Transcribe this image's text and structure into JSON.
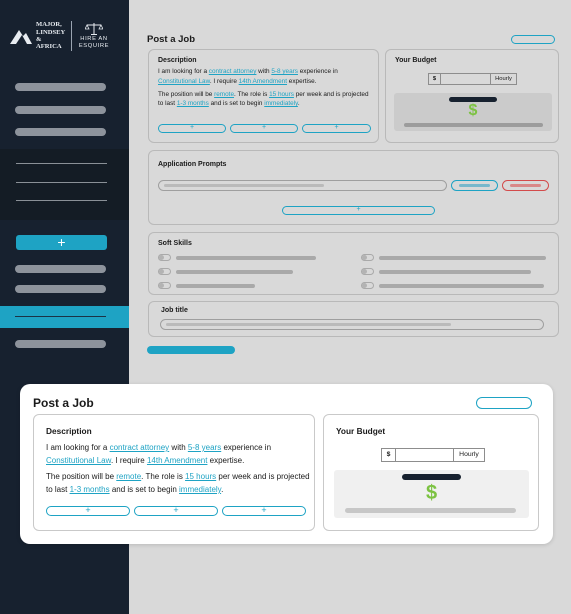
{
  "brand": {
    "left_lines": [
      "MAJOR,",
      "LINDSEY",
      "& AFRICA"
    ],
    "right_lines": [
      "HIRE AN",
      "ESQUIRE"
    ]
  },
  "sidebar": {
    "add_label": "+"
  },
  "page": {
    "title": "Post a Job"
  },
  "description": {
    "heading": "Description",
    "line1_a": "I am looking for a ",
    "role": "contract attorney",
    "line1_b": " with ",
    "experience": "5-8 years",
    "line1_c": " experience in ",
    "area": "Constitutional Law",
    "line1_d": ". I require ",
    "requirement": "14th Amendment",
    "line1_e": " expertise.",
    "line2_a": "The position will be ",
    "location": "remote",
    "line2_b": ". The role is ",
    "hours": "15 hours",
    "line2_c": " per week and is projected to last ",
    "duration": "1-3 months",
    "line2_d": " and is set to begin ",
    "start": "immediately",
    "line2_e": ".",
    "add_labels": [
      "+",
      "+",
      "+"
    ]
  },
  "budget": {
    "heading": "Your Budget",
    "currency": "$",
    "amount": "",
    "unit": "Hourly",
    "icon": "dollar-icon",
    "symbol": "$"
  },
  "application_prompts": {
    "heading": "Application Prompts",
    "add_label": "+"
  },
  "soft_skills": {
    "heading": "Soft Skills"
  },
  "job_title": {
    "heading": "Job title"
  },
  "colors": {
    "accent": "#1ea3c4",
    "navy": "#17212f",
    "money": "#7cc242",
    "danger": "#d34b4b"
  }
}
